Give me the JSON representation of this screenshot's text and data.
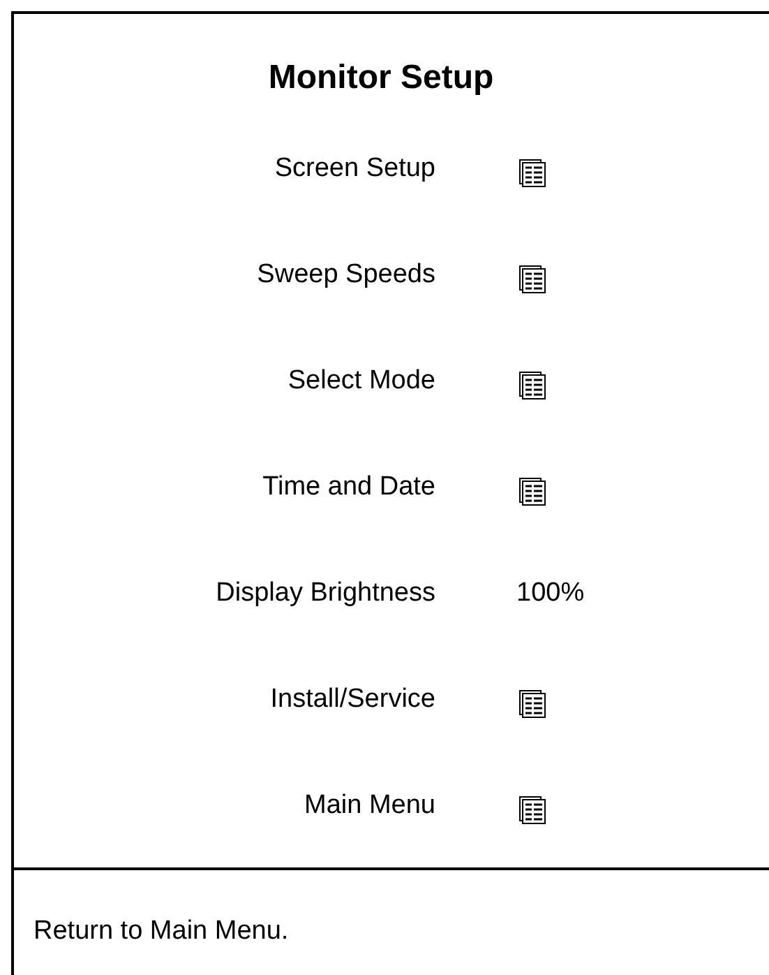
{
  "title": "Monitor Setup",
  "items": [
    {
      "label": "Screen Setup",
      "kind": "menu"
    },
    {
      "label": "Sweep Speeds",
      "kind": "menu"
    },
    {
      "label": "Select Mode",
      "kind": "menu"
    },
    {
      "label": "Time and Date",
      "kind": "menu"
    },
    {
      "label": "Display Brightness",
      "kind": "value",
      "value": "100%"
    },
    {
      "label": "Install/Service",
      "kind": "menu"
    },
    {
      "label": "Main Menu",
      "kind": "menu"
    }
  ],
  "help_text": "Return to Main Menu."
}
